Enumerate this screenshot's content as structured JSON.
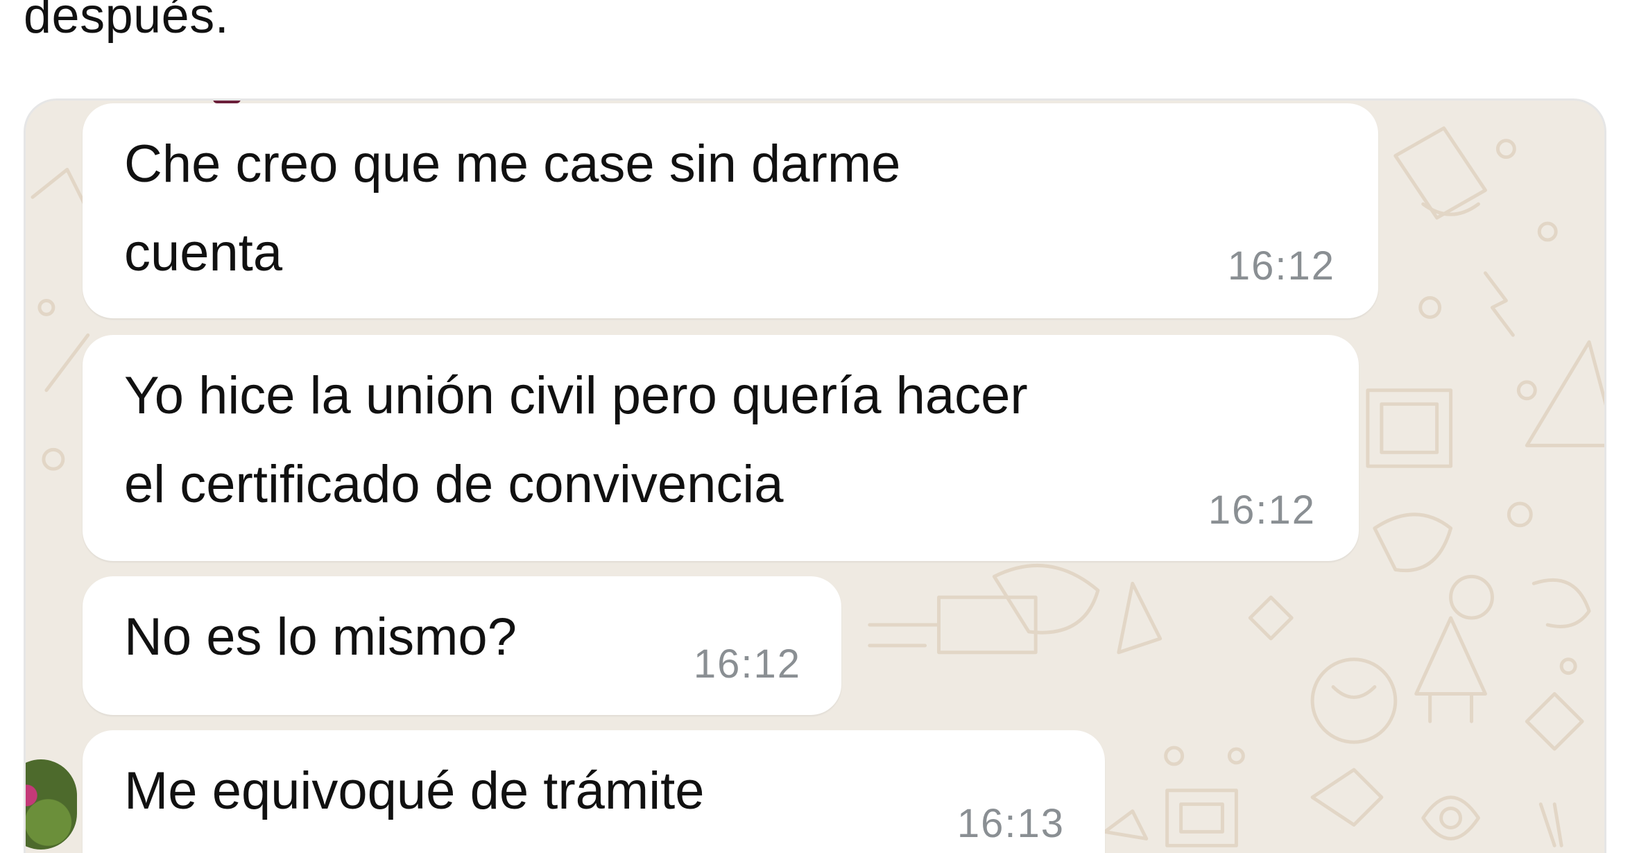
{
  "caption": "después.",
  "chat": {
    "background_color": "#efeae2",
    "bubble_color": "#ffffff",
    "messages": [
      {
        "text": "Che creo que me case sin darme\ncuenta",
        "time": "16:12"
      },
      {
        "text": "Yo hice la unión civil pero quería hacer\nel certificado de convivencia",
        "time": "16:12"
      },
      {
        "text": "No es lo mismo?",
        "time": "16:12"
      },
      {
        "text": "Me equivoqué de trámite",
        "time": "16:13"
      }
    ]
  }
}
